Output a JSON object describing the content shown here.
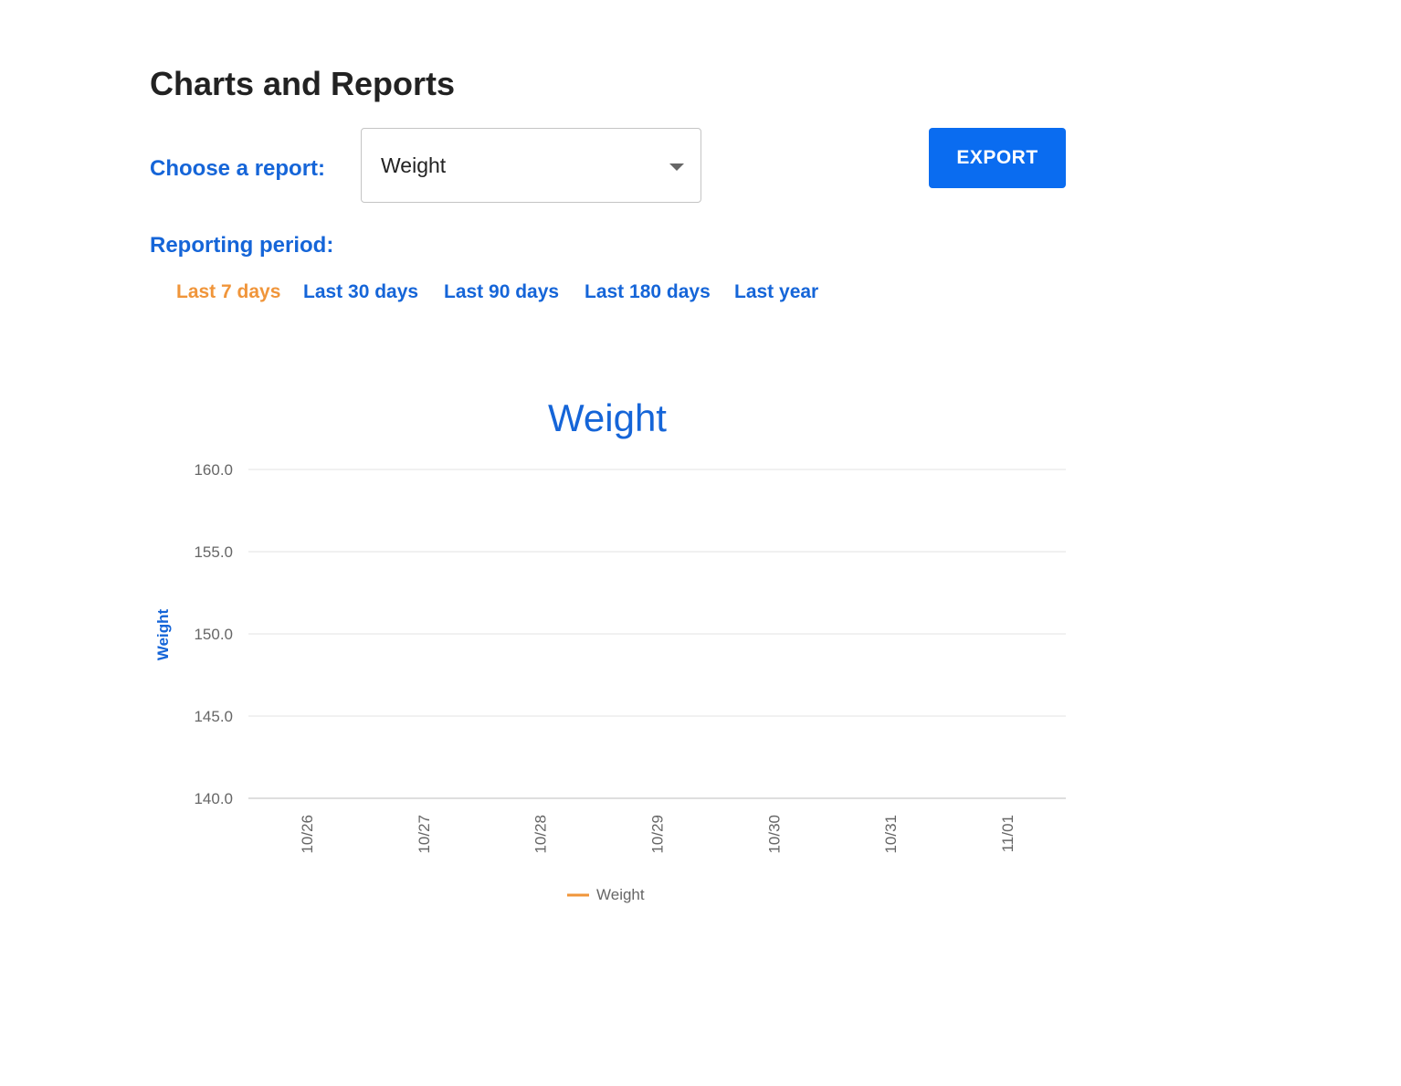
{
  "page": {
    "title": "Charts and Reports"
  },
  "report": {
    "label": "Choose a report:",
    "selected": "Weight",
    "export_label": "EXPORT"
  },
  "period": {
    "label": "Reporting period:",
    "options": [
      {
        "label": "Last 7 days",
        "active": true
      },
      {
        "label": "Last 30 days",
        "active": false
      },
      {
        "label": "Last 90 days",
        "active": false
      },
      {
        "label": "Last 180 days",
        "active": false
      },
      {
        "label": "Last year",
        "active": false
      }
    ]
  },
  "colors": {
    "accent": "#1565d8",
    "active_period": "#f0953a",
    "button": "#0a6cf0",
    "series": "#f0953a"
  },
  "chart_data": {
    "type": "line",
    "title": "Weight",
    "xlabel": "",
    "ylabel": "Weight",
    "categories": [
      "10/26",
      "10/27",
      "10/28",
      "10/29",
      "10/30",
      "10/31",
      "11/01"
    ],
    "y_ticks": [
      "160.0",
      "155.0",
      "150.0",
      "145.0",
      "140.0"
    ],
    "ylim": [
      140,
      160
    ],
    "grid": true,
    "legend_position": "bottom",
    "series": [
      {
        "name": "Weight",
        "color": "#f0953a",
        "values": [
          null,
          null,
          null,
          null,
          null,
          null,
          null
        ]
      }
    ]
  }
}
